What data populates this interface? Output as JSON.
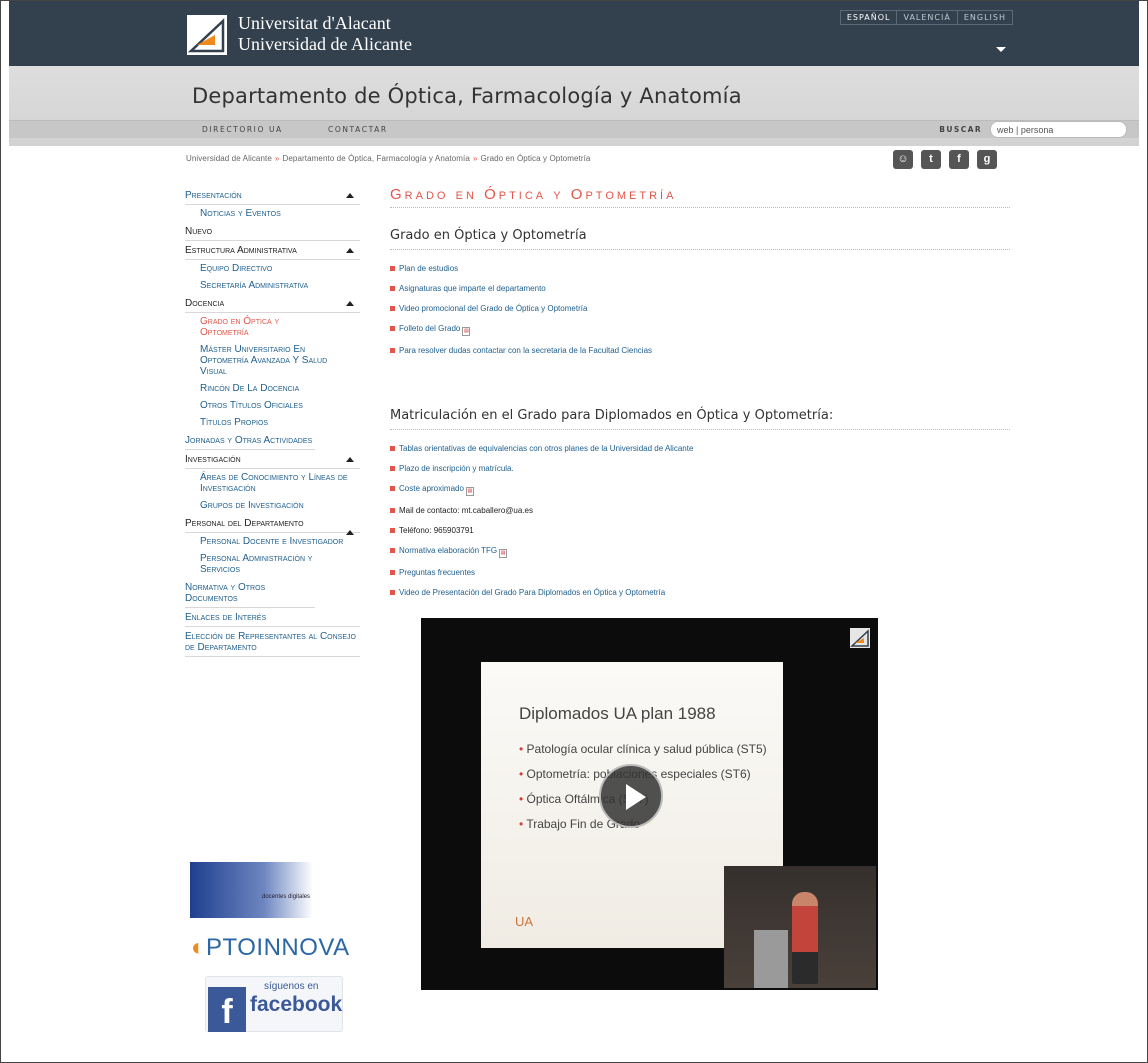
{
  "header": {
    "university_line1": "Universitat d'Alacant",
    "university_line2": "Universidad de Alicante",
    "languages": [
      "ESPAÑOL",
      "VALENCIÀ",
      "ENGLISH"
    ]
  },
  "department": {
    "title": "Departamento de Óptica, Farmacología y Anatomía",
    "subnav": [
      "DIRECTORIO UA",
      "CONTACTAR"
    ],
    "search_label": "BUSCAR",
    "search_value": "web | persona"
  },
  "breadcrumb": [
    "Universidad de Alicante",
    "Departamento de Óptica, Farmacología y Anatomía",
    "Grado en Óptica y Optometría"
  ],
  "sidebar": {
    "items": [
      {
        "label": "Presentación"
      },
      {
        "label": "Noticias y Eventos"
      },
      {
        "label": "Nuevo"
      },
      {
        "label": "Estructura Administrativa"
      },
      {
        "label": "Equipo Directivo"
      },
      {
        "label": "Secretaría Administrativa"
      },
      {
        "label": "Docencia"
      },
      {
        "label": "Grado en Óptica y Optometría"
      },
      {
        "label": "Máster Universitario En Optometría Avanzada Y Salud Visual"
      },
      {
        "label": "Rincón De La Docencia"
      },
      {
        "label": "Otros Títulos Oficiales"
      },
      {
        "label": "Títulos Propios"
      },
      {
        "label": "Jornadas y Otras Actividades"
      },
      {
        "label": "Investigación"
      },
      {
        "label": "Áreas de Conocimiento y Líneas de Investigación"
      },
      {
        "label": "Grupos de Investigación"
      },
      {
        "label": "Personal del Departamento"
      },
      {
        "label": "Personal Docente e Investigador"
      },
      {
        "label": "Personal Administración y Servicios"
      },
      {
        "label": "Normativa y Otros Documentos"
      },
      {
        "label": "Enlaces de Interés"
      },
      {
        "label": "Elección de Representantes al Consejo de Departamento"
      }
    ],
    "badge_docentes": "docentes\ndigitales",
    "optoinnova": "PTOINNOVA",
    "fb_siguenos": "síguenos en",
    "fb_word": "facebook"
  },
  "main": {
    "page_heading": "Grado en Óptica y Optometría",
    "section1_title": "Grado en Óptica y Optometría",
    "section1_links": [
      "Plan de estudios",
      "Asignaturas que imparte el departamento",
      "Video promocional del Grado de Óptica y Optometría",
      "Folleto del Grado",
      "Para resolver dudas contactar con la secretaria de la Facultad Ciencias"
    ],
    "section2_title": "Matriculación en el Grado para Diplomados en Óptica y Optometría:",
    "section2_links": [
      "Tablas orientativas de equivalencias con otros planes de la Universidad de Alicante",
      "Plazo de inscripción y matrícula.",
      "Coste aproximado",
      "Mail de contacto: mt.caballero@ua.es",
      "Teléfono: 965903791",
      "Normativa elaboración TFG",
      "Preguntas frecuentes",
      "Video de Presentación del Grado Para Diplomados en Óptica y Optometría"
    ]
  },
  "video": {
    "slide_title": "Diplomados UA plan 1988",
    "bullets": [
      "Patología ocular clínica y salud pública (ST5)",
      "Optometría: poblaciones especiales (ST6)",
      "Óptica Oftálmica (ST7)",
      "Trabajo Fin de Grado"
    ],
    "slide_footer": "UA"
  },
  "colors": {
    "accent": "#e2564a",
    "link": "#1e5f8e",
    "header": "#33414e"
  }
}
